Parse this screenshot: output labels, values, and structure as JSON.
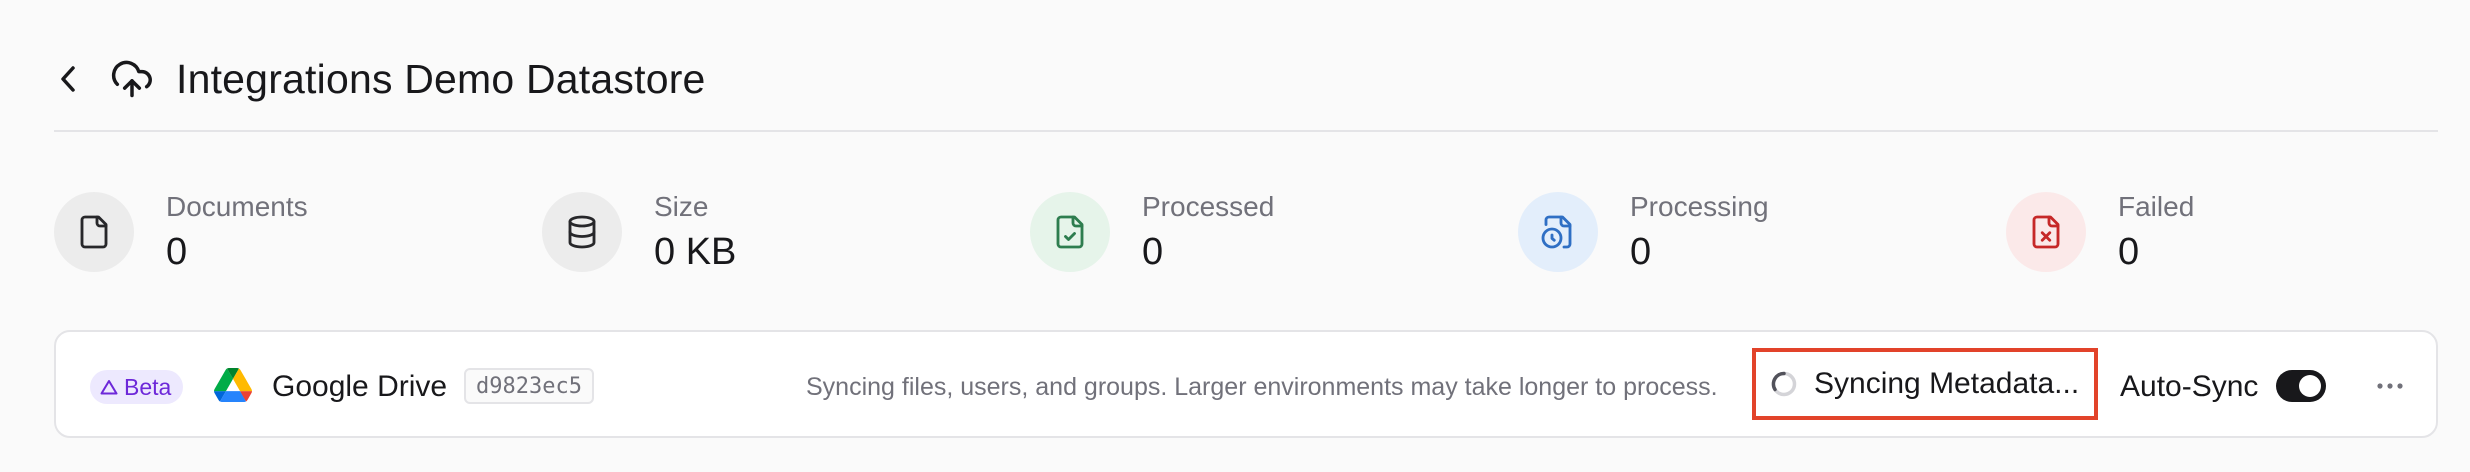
{
  "header": {
    "title": "Integrations Demo Datastore",
    "back_icon": "chevron-left-icon",
    "datastore_icon": "cloud-upload-icon"
  },
  "stats": [
    {
      "label": "Documents",
      "value": "0",
      "icon": "file-icon",
      "bg": "#ececec",
      "fg": "#27272a"
    },
    {
      "label": "Size",
      "value": "0 KB",
      "icon": "database-icon",
      "bg": "#ececec",
      "fg": "#27272a"
    },
    {
      "label": "Processed",
      "value": "0",
      "icon": "file-check-icon",
      "bg": "#e6f4ea",
      "fg": "#2e7d4f"
    },
    {
      "label": "Processing",
      "value": "0",
      "icon": "file-clock-icon",
      "bg": "#e3eefb",
      "fg": "#2f6fc4"
    },
    {
      "label": "Failed",
      "value": "0",
      "icon": "file-x-icon",
      "bg": "#fbe9e9",
      "fg": "#c62828"
    }
  ],
  "integration": {
    "badge": "Beta",
    "name": "Google Drive",
    "id": "d9823ec5",
    "message": "Syncing files, users, and groups. Larger environments may take longer to process.",
    "status": "Syncing Metadata...",
    "autosync_label": "Auto-Sync",
    "autosync_enabled": true
  },
  "colors": {
    "highlight": "#e2432a",
    "beta_bg": "#ede9fe",
    "beta_fg": "#6d28d9"
  }
}
